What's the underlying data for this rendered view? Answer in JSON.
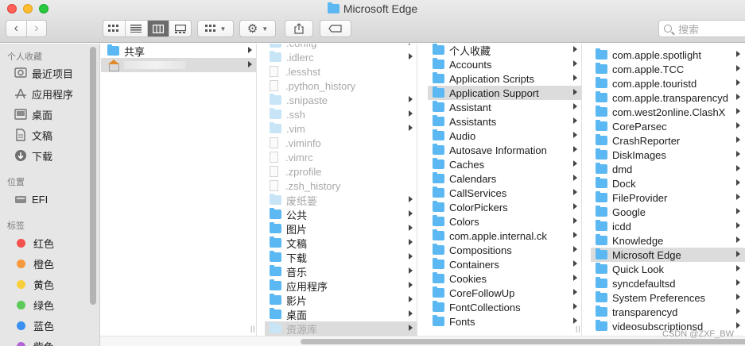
{
  "window": {
    "title": "Microsoft Edge"
  },
  "toolbar": {
    "search_placeholder": "搜索",
    "nav_back": "‹",
    "nav_forward": "›"
  },
  "sidebar": {
    "favorites_header": "个人收藏",
    "favorites": [
      {
        "label": "最近项目",
        "icon": "clock-icon"
      },
      {
        "label": "应用程序",
        "icon": "applications-icon"
      },
      {
        "label": "桌面",
        "icon": "desktop-icon"
      },
      {
        "label": "文稿",
        "icon": "document-icon"
      },
      {
        "label": "下载",
        "icon": "download-icon"
      }
    ],
    "locations_header": "位置",
    "locations": [
      {
        "label": "EFI",
        "icon": "drive-icon"
      }
    ],
    "tags_header": "标签",
    "tags": [
      {
        "label": "红色",
        "color": "#f2514c"
      },
      {
        "label": "橙色",
        "color": "#f7993b"
      },
      {
        "label": "黄色",
        "color": "#f8ce3c"
      },
      {
        "label": "绿色",
        "color": "#5ccb5a"
      },
      {
        "label": "蓝色",
        "color": "#3b8ff0"
      },
      {
        "label": "紫色",
        "color": "#b464d6"
      }
    ]
  },
  "columns": {
    "col1": [
      "共享"
    ],
    "col2": [
      {
        "label": ".config",
        "dim": true,
        "arrow": true
      },
      {
        "label": ".idlerc",
        "dim": true,
        "arrow": true
      },
      {
        "label": ".lesshst",
        "dim": true,
        "arrow": false
      },
      {
        "label": ".python_history",
        "dim": true,
        "arrow": false
      },
      {
        "label": ".snipaste",
        "dim": true,
        "arrow": true
      },
      {
        "label": ".ssh",
        "dim": true,
        "arrow": true
      },
      {
        "label": ".vim",
        "dim": true,
        "arrow": true
      },
      {
        "label": ".viminfo",
        "dim": true,
        "arrow": false
      },
      {
        "label": ".vimrc",
        "dim": true,
        "arrow": false
      },
      {
        "label": ".zprofile",
        "dim": true,
        "arrow": false
      },
      {
        "label": ".zsh_history",
        "dim": true,
        "arrow": false
      },
      {
        "label": "废纸篓",
        "dim": true,
        "arrow": true
      },
      {
        "label": "公共",
        "dim": false,
        "arrow": true
      },
      {
        "label": "图片",
        "dim": false,
        "arrow": true
      },
      {
        "label": "文稿",
        "dim": false,
        "arrow": true
      },
      {
        "label": "下载",
        "dim": false,
        "arrow": true
      },
      {
        "label": "音乐",
        "dim": false,
        "arrow": true
      },
      {
        "label": "应用程序",
        "dim": false,
        "arrow": true
      },
      {
        "label": "影片",
        "dim": false,
        "arrow": true
      },
      {
        "label": "桌面",
        "dim": false,
        "arrow": true
      },
      {
        "label": "资源库",
        "dim": true,
        "arrow": true,
        "selected": true
      }
    ],
    "col3": [
      "个人收藏",
      "Accounts",
      "Application Scripts",
      "Application Support",
      "Assistant",
      "Assistants",
      "Audio",
      "Autosave Information",
      "Caches",
      "Calendars",
      "CallServices",
      "ColorPickers",
      "Colors",
      "com.apple.internal.ck",
      "Compositions",
      "Containers",
      "Cookies",
      "CoreFollowUp",
      "FontCollections",
      "Fonts"
    ],
    "col4": [
      "com.apple.spotlight",
      "com.apple.TCC",
      "com.apple.touristd",
      "com.apple.transparencyd",
      "com.west2online.ClashX",
      "CoreParsec",
      "CrashReporter",
      "DiskImages",
      "dmd",
      "Dock",
      "FileProvider",
      "Google",
      "icdd",
      "Knowledge",
      "Microsoft Edge",
      "Quick Look",
      "syncdefaultsd",
      "System Preferences",
      "transparencyd",
      "videosubscriptionsd"
    ]
  },
  "watermark": "CSDN @ZXF_BW"
}
